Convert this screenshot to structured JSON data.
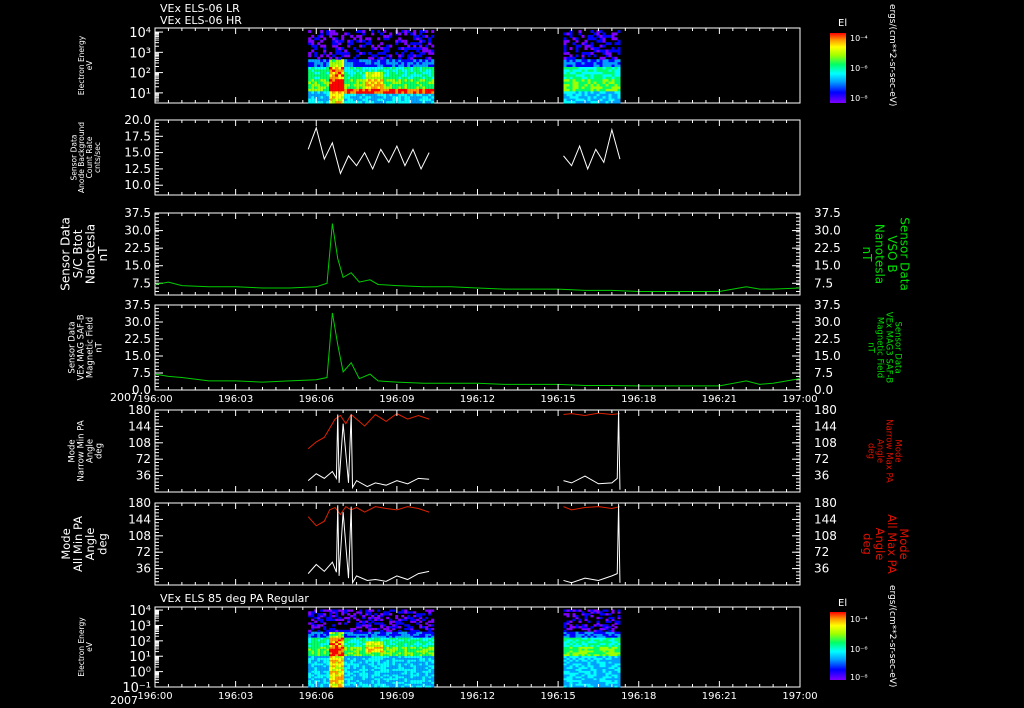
{
  "header": {
    "line1": "VEx ELS-06 LR",
    "line2": "VEx ELS-06 HR",
    "bottom_panel_title": "VEx ELS 85 deg PA Regular"
  },
  "time_axis": {
    "year": "2007",
    "ticks": [
      "196:00",
      "196:03",
      "196:06",
      "196:09",
      "196:12",
      "196:15",
      "196:18",
      "196:21",
      "197:00"
    ],
    "range_hours": [
      0,
      24
    ]
  },
  "colorbar": {
    "label": "El",
    "ticks": [
      "10⁻⁴",
      "10⁻⁶",
      "10⁻⁸"
    ],
    "unit": "ergs/(cm**2-sr-sec-eV)",
    "colors": [
      "#7f00ff",
      "#0000ff",
      "#00a0ff",
      "#00ffff",
      "#00ff66",
      "#a0ff00",
      "#ffff00",
      "#ff9900",
      "#ff0000"
    ]
  },
  "colors": {
    "background": "#000000",
    "axis": "#ffffff",
    "green_trace": "#00cc00",
    "red_trace": "#dd2200",
    "white_trace": "#ffffff",
    "green_label": "#00dd00",
    "red_label": "#dd1100"
  },
  "chart_data": [
    {
      "type": "heatmap",
      "panel": "p1",
      "ylabel": [
        "Electron Energy",
        "eV"
      ],
      "y_ticks": [
        "10⁴",
        "10³",
        "10²",
        "10¹"
      ],
      "y_log_range": [
        0.5,
        4.2
      ],
      "data_intervals_hours": [
        [
          5.7,
          10.3
        ],
        [
          15.2,
          17.3
        ]
      ]
    },
    {
      "type": "line",
      "panel": "p2",
      "ylabel": [
        "Sensor Data",
        "Anode Background",
        "Count Rate",
        "cnts/sec"
      ],
      "ylim": [
        8.5,
        20.0
      ],
      "y_ticks": [
        "20.0",
        "17.5",
        "15.0",
        "12.5",
        "10.0"
      ],
      "series": [
        {
          "color": "white",
          "x": [
            5.7,
            6.0,
            6.3,
            6.6,
            6.9,
            7.2,
            7.5,
            7.8,
            8.1,
            8.4,
            8.7,
            9.0,
            9.3,
            9.6,
            9.9,
            10.2,
            15.2,
            15.5,
            15.8,
            16.1,
            16.4,
            16.7,
            17.0,
            17.3
          ],
          "values": [
            15.5,
            18.8,
            14.0,
            16.5,
            11.8,
            14.5,
            13.0,
            15.0,
            12.5,
            15.5,
            13.5,
            16.0,
            13.0,
            15.5,
            12.5,
            15.0,
            14.5,
            13.0,
            16.0,
            12.5,
            15.5,
            13.5,
            18.5,
            14.0
          ]
        }
      ]
    },
    {
      "type": "line",
      "panel": "p3",
      "ylabel": [
        "Sensor Data",
        "S/C Btot",
        "Nanotesla",
        "nT"
      ],
      "right_label": [
        "Sensor Data",
        "VSO B",
        "Nanotesla",
        "nT"
      ],
      "ylim": [
        2.5,
        37.5
      ],
      "y_ticks": [
        "37.5",
        "30.0",
        "22.5",
        "15.0",
        "7.5"
      ],
      "series": [
        {
          "color": "green",
          "x": [
            0,
            0.5,
            1,
            2,
            3,
            4,
            5,
            6,
            6.4,
            6.6,
            6.8,
            7.0,
            7.3,
            7.6,
            8.0,
            8.3,
            9,
            10,
            11,
            12,
            13,
            14,
            15,
            16,
            17,
            18,
            19,
            20,
            21,
            22,
            22.5,
            23,
            24
          ],
          "values": [
            7.0,
            8.0,
            6.5,
            6.0,
            6.0,
            5.5,
            5.5,
            6.0,
            7.5,
            33.0,
            18.0,
            10.0,
            12.0,
            8.0,
            9.0,
            7.0,
            6.5,
            6.0,
            6.0,
            5.5,
            5.0,
            5.0,
            5.0,
            4.5,
            4.5,
            4.0,
            4.0,
            4.0,
            4.0,
            6.0,
            5.0,
            5.0,
            5.5
          ]
        }
      ]
    },
    {
      "type": "line",
      "panel": "p4",
      "ylabel": [
        "Sensor Data",
        "VEx MAG SAF-B",
        "Magnetic Field",
        "nT"
      ],
      "right_label": [
        "Sensor Data",
        "VEx MAG3 SAF-B",
        "Magnetic Field",
        "nT"
      ],
      "ylim": [
        0.0,
        37.5
      ],
      "y_ticks": [
        "37.5",
        "30.0",
        "22.5",
        "15.0",
        "7.5",
        "0.0"
      ],
      "series": [
        {
          "color": "green",
          "x": [
            0,
            0.5,
            1,
            2,
            3,
            4,
            5,
            6,
            6.4,
            6.6,
            6.8,
            7.0,
            7.3,
            7.6,
            8.0,
            8.3,
            9,
            10,
            11,
            12,
            13,
            14,
            15,
            16,
            17,
            18,
            19,
            20,
            21,
            22,
            22.5,
            23,
            24
          ],
          "values": [
            7.0,
            6.0,
            5.5,
            4.0,
            4.0,
            3.5,
            4.0,
            4.5,
            5.5,
            34.0,
            20.0,
            8.0,
            12.0,
            5.0,
            7.0,
            4.0,
            3.5,
            3.0,
            3.0,
            3.0,
            2.5,
            2.5,
            2.5,
            2.0,
            2.0,
            1.8,
            1.8,
            1.8,
            1.8,
            4.0,
            2.5,
            3.0,
            5.0
          ]
        }
      ]
    },
    {
      "type": "line",
      "panel": "p5",
      "ylabel": [
        "Mode",
        "Narrow Min PA",
        "Angle",
        "deg"
      ],
      "right_label": [
        "Mode",
        "Narrow Max PA",
        "Angle",
        "deg"
      ],
      "ylim": [
        0,
        180
      ],
      "y_ticks": [
        "180",
        "144",
        "108",
        "72",
        "36"
      ],
      "series": [
        {
          "color": "red",
          "x": [
            5.7,
            6.0,
            6.3,
            6.5,
            6.7,
            6.9,
            7.1,
            7.3,
            7.5,
            7.8,
            8.2,
            8.6,
            9.0,
            9.4,
            9.8,
            10.2,
            15.2,
            15.5,
            16.0,
            16.5,
            17.0,
            17.3
          ],
          "values": [
            95,
            110,
            120,
            140,
            160,
            168,
            150,
            170,
            160,
            145,
            170,
            155,
            172,
            160,
            168,
            160,
            170,
            172,
            168,
            173,
            170,
            172
          ]
        },
        {
          "color": "white",
          "x": [
            5.7,
            6.0,
            6.3,
            6.6,
            6.75,
            6.8,
            6.85,
            7.0,
            7.2,
            7.3,
            7.35,
            7.5,
            7.9,
            8.2,
            8.6,
            9.0,
            9.4,
            9.8,
            10.2,
            15.2,
            15.5,
            16.0,
            16.5,
            17.0,
            17.2,
            17.25,
            17.3
          ],
          "values": [
            25,
            40,
            30,
            45,
            30,
            170,
            20,
            150,
            20,
            170,
            10,
            25,
            12,
            20,
            15,
            25,
            18,
            30,
            28,
            25,
            20,
            35,
            18,
            20,
            30,
            178,
            5
          ]
        }
      ]
    },
    {
      "type": "line",
      "panel": "p6",
      "ylabel": [
        "Mode",
        "All Min PA",
        "Angle",
        "deg"
      ],
      "right_label": [
        "Mode",
        "All Max PA",
        "Angle",
        "deg"
      ],
      "ylim": [
        0,
        180
      ],
      "y_ticks": [
        "180",
        "144",
        "108",
        "72",
        "36"
      ],
      "series": [
        {
          "color": "red",
          "x": [
            5.7,
            6.0,
            6.3,
            6.5,
            6.7,
            6.9,
            7.1,
            7.3,
            7.5,
            7.8,
            8.2,
            8.6,
            9.0,
            9.4,
            9.8,
            10.2,
            15.2,
            15.5,
            16.0,
            16.5,
            17.0,
            17.3
          ],
          "values": [
            150,
            130,
            140,
            165,
            170,
            155,
            172,
            165,
            170,
            160,
            172,
            168,
            165,
            172,
            168,
            160,
            172,
            165,
            170,
            172,
            168,
            172
          ],
          "name": ""
        },
        {
          "color": "white",
          "x": [
            5.7,
            6.0,
            6.3,
            6.6,
            6.75,
            6.8,
            6.85,
            7.0,
            7.2,
            7.3,
            7.35,
            7.5,
            7.9,
            8.2,
            8.6,
            9.0,
            9.4,
            9.8,
            10.2,
            15.2,
            15.5,
            16.0,
            16.5,
            17.0,
            17.2,
            17.25,
            17.3
          ],
          "values": [
            25,
            45,
            30,
            50,
            28,
            175,
            20,
            160,
            15,
            172,
            5,
            20,
            10,
            12,
            8,
            20,
            12,
            25,
            30,
            10,
            5,
            15,
            10,
            20,
            25,
            178,
            5
          ]
        }
      ]
    },
    {
      "type": "heatmap",
      "panel": "p7",
      "ylabel": [
        "Electron Energy",
        "eV"
      ],
      "y_ticks": [
        "10⁴",
        "10³",
        "10²",
        "10¹",
        "10⁰",
        "10⁻¹"
      ],
      "y_log_range": [
        -1.0,
        4.2
      ],
      "data_intervals_hours": [
        [
          5.7,
          10.3
        ],
        [
          15.2,
          17.3
        ]
      ]
    }
  ]
}
